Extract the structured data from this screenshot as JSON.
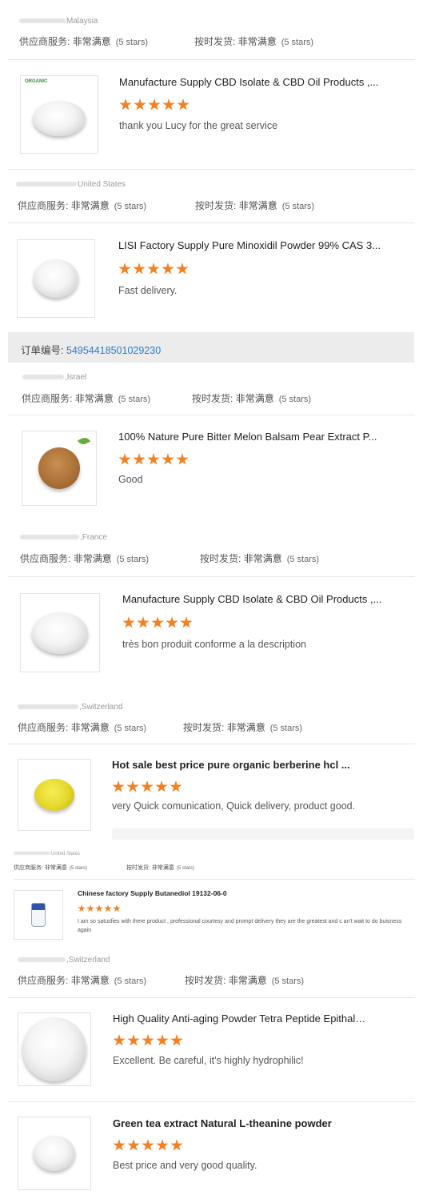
{
  "labels": {
    "supplier_service": "供应商服务:",
    "on_time": "按时发货:",
    "very_satisfied": "非常满意",
    "five_stars": "(5 stars)"
  },
  "order": {
    "label": "订单编号:",
    "number": "54954418501029230"
  },
  "reviews": [
    {
      "country": "Malaysia",
      "product": "",
      "comment": ""
    },
    {
      "country": "United States",
      "product": "Manufacture Supply CBD Isolate & CBD Oil Products ,...",
      "comment": "thank you Lucy for the great service",
      "logo": "ORGANIC"
    },
    {
      "country": "Israel",
      "product": "LISI Factory Supply Pure Minoxidil Powder 99% CAS 3...",
      "comment": "Fast delivery."
    },
    {
      "country": "France",
      "product": "100% Nature Pure Bitter Melon Balsam Pear Extract P...",
      "comment": "Good"
    },
    {
      "country": "Switzerland",
      "product": "Manufacture Supply CBD Isolate & CBD Oil Products ,...",
      "comment": "très bon produit conforme a la description"
    },
    {
      "country": "United States",
      "product": "Hot sale best price pure organic berberine hcl ...",
      "comment": "very Quick comunication, Quick delivery, product good."
    },
    {
      "country": "Switzerland",
      "product": "Chinese factory Supply Butanediol 19132-06-0",
      "comment": "I am so satusfies with there product , professional courtesy and prompt delivery they are the greatest and c an't wait to do buisness again"
    },
    {
      "country": "",
      "product": "High Quality Anti-aging Powder Tetra Peptide Epithalo...",
      "comment": "Excellent. Be careful, it's highly hydrophilic!"
    },
    {
      "country": "",
      "product": "Green tea extract Natural L-theanine powder",
      "comment": "Best price and very good quality."
    }
  ],
  "rating": 5,
  "colors": {
    "star": "#f4801f",
    "link": "#2a7cc7"
  }
}
